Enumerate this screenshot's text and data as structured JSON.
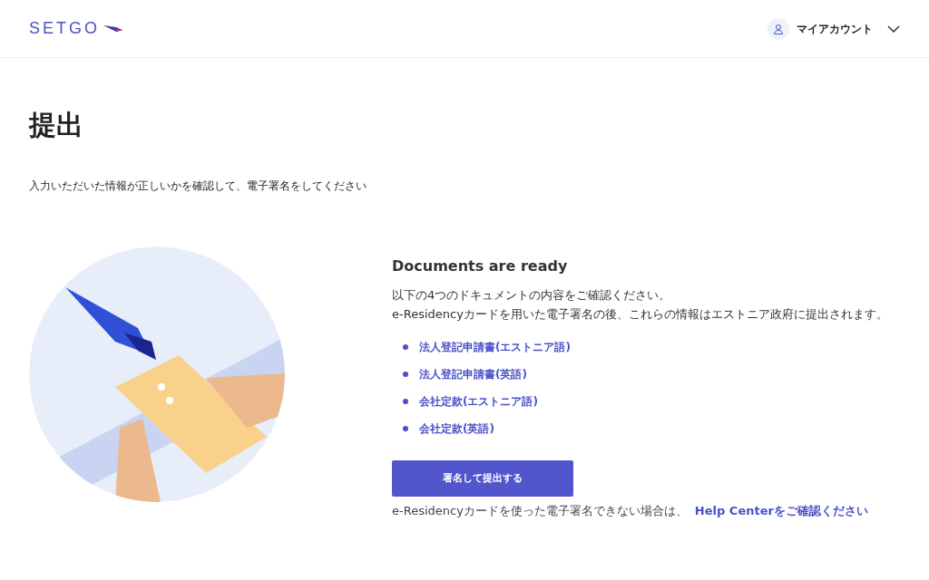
{
  "header": {
    "logo": "SETGO",
    "account": {
      "label": "マイアカウント"
    }
  },
  "page": {
    "title": "提出",
    "subtitle": "入力いただいた情報が正しいかを確認して、電子署名をしてください"
  },
  "documents": {
    "heading": "Documents are ready",
    "description": [
      "以下の4つのドキュメントの内容をご確認ください。",
      "e-Residencyカードを用いた電子署名の後、これらの情報はエストニア政府に提出されます。"
    ],
    "items": [
      "法人登記申請書(エストニア語)",
      "法人登記申請書(英語)",
      "会社定款(エストニア語)",
      "会社定款(英語)"
    ],
    "submit_button": "署名して提出する",
    "help_text": "e-Residencyカードを使った電子署名できない場合は、",
    "help_link": "Help Centerをご確認ください"
  }
}
